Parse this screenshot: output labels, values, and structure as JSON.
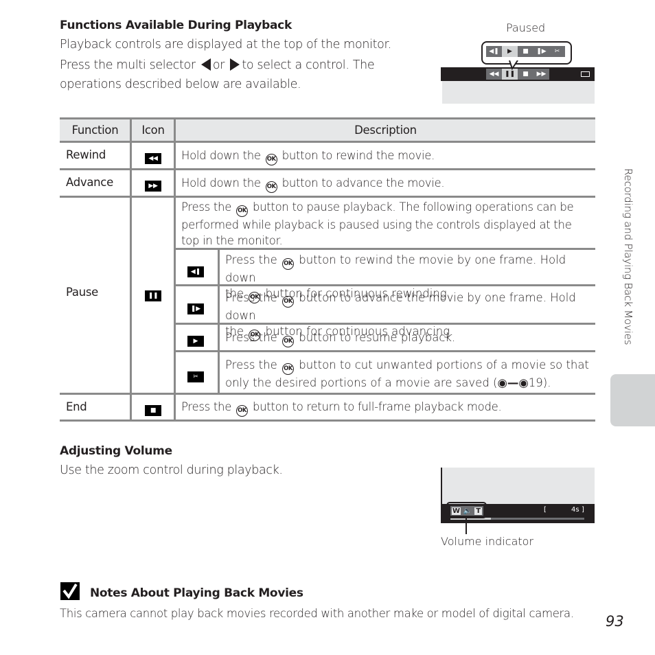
{
  "section1": {
    "heading": "Functions Available During Playback",
    "line1": "Playback controls are displayed at the top of the monitor.",
    "line2_pre": "Press the multi selector",
    "line2_or": "or",
    "line2_post": "to select a control. The",
    "line3": "operations described below are available.",
    "left_arrow_icon": "multi-selector-left",
    "right_arrow_icon": "multi-selector-right"
  },
  "illustration_top": {
    "label": "Paused",
    "popup_controls": [
      "frame-rewind",
      "play",
      "stop",
      "frame-advance",
      "cut"
    ],
    "popup_selected_index": 1,
    "bar_controls": [
      "rewind",
      "pause",
      "stop",
      "advance"
    ],
    "bar_selected_index": 1,
    "battery_icon": "battery-icon"
  },
  "table": {
    "headers": [
      "Function",
      "Icon",
      "Description"
    ],
    "ok_label": "OK",
    "rows": [
      {
        "function": "Rewind",
        "icon": "rewind",
        "desc_pre": "Hold down the",
        "desc_post": "button to rewind the movie."
      },
      {
        "function": "Advance",
        "icon": "advance",
        "desc_pre": "Hold down the",
        "desc_post": "button to advance the movie."
      },
      {
        "function": "Pause",
        "icon": "pause",
        "desc_pre": "Press the",
        "desc_post": "button to pause playback. The following operations can be performed while playback is paused using the controls displayed at the top in the monitor.",
        "sub": [
          {
            "icon": "frame-rewind",
            "l1_pre": "Press the",
            "l1_post": "button to rewind the movie by one frame. Hold down",
            "l2_pre": "the",
            "l2_post": "button for continuous rewinding."
          },
          {
            "icon": "frame-advance",
            "l1_pre": "Press the",
            "l1_post": "button to advance the movie by one frame. Hold down",
            "l2_pre": "the",
            "l2_post": "button for continuous advancing."
          },
          {
            "icon": "play",
            "l1_pre": "Press the",
            "l1_post": "button to resume playback.",
            "l2_pre": "",
            "l2_post": ""
          },
          {
            "icon": "cut",
            "l1_pre": "Press the",
            "l1_post": "button to cut unwanted portions of a movie so that",
            "l2_pre": "only the desired portions of a movie are saved (",
            "l2_ref": "19",
            "l2_post": ")."
          }
        ]
      },
      {
        "function": "End",
        "icon": "stop",
        "desc_pre": "Press the",
        "desc_post": "button to return to full-frame playback mode."
      }
    ]
  },
  "section2": {
    "heading": "Adjusting Volume",
    "text": "Use the zoom control during playback."
  },
  "illustration_bottom": {
    "w_label": "W",
    "t_label": "T",
    "time_open": "[",
    "time_value": "4s",
    "time_close": "]",
    "progress": 0.3,
    "callout": "Volume indicator"
  },
  "notes": {
    "heading": "Notes About Playing Back Movies",
    "text": "This camera cannot play back movies recorded with another make or model of digital camera."
  },
  "side": {
    "label": "Recording and Playing Back Movies"
  },
  "page_number": "93"
}
